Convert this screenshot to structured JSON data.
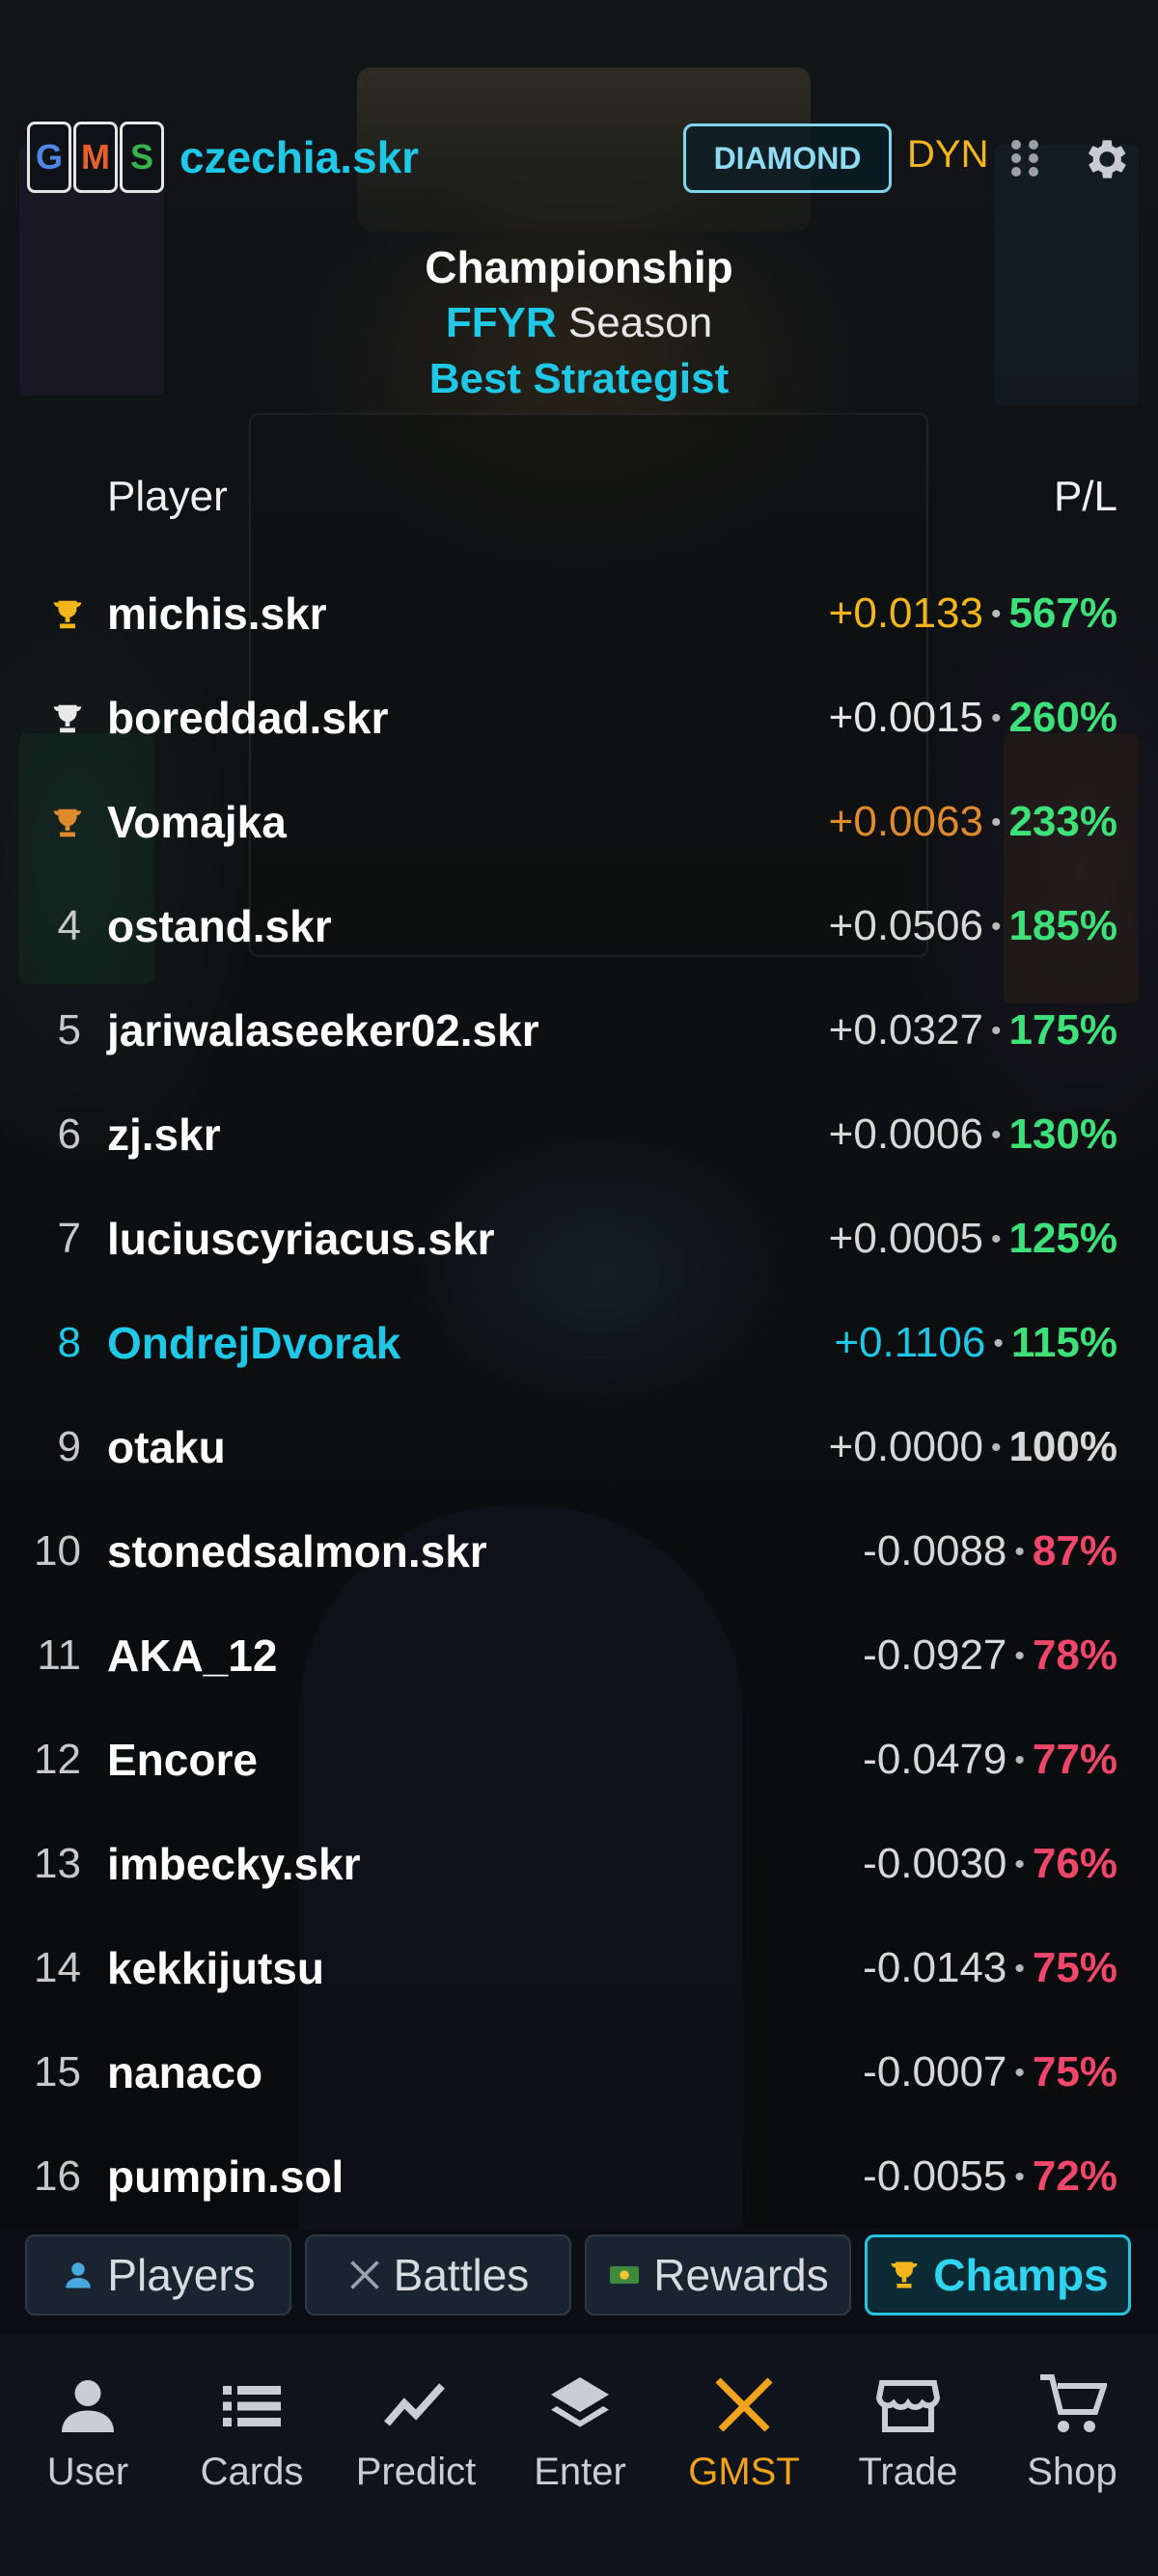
{
  "header": {
    "logo": [
      "G",
      "M",
      "S"
    ],
    "logo_colors": [
      "#4f86e8",
      "#e8602c",
      "#37b24d"
    ],
    "username": "czechia.skr",
    "tier": "DIAMOND",
    "mode": "DYN",
    "menu_icon": "grid-dots-icon",
    "settings_icon": "gear-icon"
  },
  "title": {
    "line1": "Championship",
    "season_highlight": "FFYR",
    "season_rest": " Season",
    "line3": "Best Strategist"
  },
  "columns": {
    "player": "Player",
    "pl": "P/L"
  },
  "colors": {
    "accent": "#1ec8e6",
    "gain": "#3ee07a",
    "loss": "#f0466a",
    "gold": "#f3b51b",
    "silver": "#e8e8e8",
    "bronze": "#e08a2c",
    "neutral": "#e0e0e0"
  },
  "rows": [
    {
      "rank": "",
      "trophy": "gold",
      "name": "michis.skr",
      "delta": "+0.0133",
      "pct": "567%",
      "delta_color": "#f3b51b",
      "pct_color": "#3ee07a",
      "name_color": "#ffffff"
    },
    {
      "rank": "",
      "trophy": "silver",
      "name": "boreddad.skr",
      "delta": "+0.0015",
      "pct": "260%",
      "delta_color": "#e6e6e6",
      "pct_color": "#3ee07a",
      "name_color": "#ffffff"
    },
    {
      "rank": "",
      "trophy": "bronze",
      "name": "Vomajka",
      "delta": "+0.0063",
      "pct": "233%",
      "delta_color": "#e08a2c",
      "pct_color": "#3ee07a",
      "name_color": "#ffffff"
    },
    {
      "rank": "4",
      "trophy": "",
      "name": "ostand.skr",
      "delta": "+0.0506",
      "pct": "185%",
      "delta_color": "#d8d8d8",
      "pct_color": "#3ee07a",
      "name_color": "#ffffff"
    },
    {
      "rank": "5",
      "trophy": "",
      "name": "jariwalaseeker02.skr",
      "delta": "+0.0327",
      "pct": "175%",
      "delta_color": "#d8d8d8",
      "pct_color": "#3ee07a",
      "name_color": "#ffffff"
    },
    {
      "rank": "6",
      "trophy": "",
      "name": "zj.skr",
      "delta": "+0.0006",
      "pct": "130%",
      "delta_color": "#d8d8d8",
      "pct_color": "#3ee07a",
      "name_color": "#ffffff"
    },
    {
      "rank": "7",
      "trophy": "",
      "name": "luciuscyriacus.skr",
      "delta": "+0.0005",
      "pct": "125%",
      "delta_color": "#d8d8d8",
      "pct_color": "#3ee07a",
      "name_color": "#ffffff"
    },
    {
      "rank": "8",
      "trophy": "",
      "name": "OndrejDvorak",
      "delta": "+0.1106",
      "pct": "115%",
      "delta_color": "#1ec8e6",
      "pct_color": "#3ee07a",
      "name_color": "#1ec8e6"
    },
    {
      "rank": "9",
      "trophy": "",
      "name": "otaku",
      "delta": "+0.0000",
      "pct": "100%",
      "delta_color": "#d8d8d8",
      "pct_color": "#d8d8d8",
      "name_color": "#ffffff"
    },
    {
      "rank": "10",
      "trophy": "",
      "name": "stonedsalmon.skr",
      "delta": "-0.0088",
      "pct": "87%",
      "delta_color": "#d8d8d8",
      "pct_color": "#f0466a",
      "name_color": "#ffffff"
    },
    {
      "rank": "11",
      "trophy": "",
      "name": "AKA_12",
      "delta": "-0.0927",
      "pct": "78%",
      "delta_color": "#d8d8d8",
      "pct_color": "#f0466a",
      "name_color": "#ffffff"
    },
    {
      "rank": "12",
      "trophy": "",
      "name": "Encore",
      "delta": "-0.0479",
      "pct": "77%",
      "delta_color": "#d8d8d8",
      "pct_color": "#f0466a",
      "name_color": "#ffffff"
    },
    {
      "rank": "13",
      "trophy": "",
      "name": "imbecky.skr",
      "delta": "-0.0030",
      "pct": "76%",
      "delta_color": "#d8d8d8",
      "pct_color": "#f0466a",
      "name_color": "#ffffff"
    },
    {
      "rank": "14",
      "trophy": "",
      "name": "kekkijutsu",
      "delta": "-0.0143",
      "pct": "75%",
      "delta_color": "#d8d8d8",
      "pct_color": "#f0466a",
      "name_color": "#ffffff"
    },
    {
      "rank": "15",
      "trophy": "",
      "name": "nanaco",
      "delta": "-0.0007",
      "pct": "75%",
      "delta_color": "#d8d8d8",
      "pct_color": "#f0466a",
      "name_color": "#ffffff"
    },
    {
      "rank": "16",
      "trophy": "",
      "name": "pumpin.sol",
      "delta": "-0.0055",
      "pct": "72%",
      "delta_color": "#d8d8d8",
      "pct_color": "#f0466a",
      "name_color": "#ffffff"
    }
  ],
  "separator": "•",
  "tabs": [
    {
      "label": "Players",
      "icon": "person-icon",
      "active": false
    },
    {
      "label": "Battles",
      "icon": "crossed-swords-icon",
      "active": false
    },
    {
      "label": "Rewards",
      "icon": "banknote-icon",
      "active": false
    },
    {
      "label": "Champs",
      "icon": "trophy-icon",
      "active": true
    }
  ],
  "nav": [
    {
      "label": "User",
      "icon": "user-icon",
      "active": false
    },
    {
      "label": "Cards",
      "icon": "list-icon",
      "active": false
    },
    {
      "label": "Predict",
      "icon": "trend-line-icon",
      "active": false
    },
    {
      "label": "Enter",
      "icon": "layers-icon",
      "active": false
    },
    {
      "label": "GMST",
      "icon": "crossed-swords-icon",
      "active": true
    },
    {
      "label": "Trade",
      "icon": "storefront-icon",
      "active": false
    },
    {
      "label": "Shop",
      "icon": "cart-icon",
      "active": false
    }
  ]
}
